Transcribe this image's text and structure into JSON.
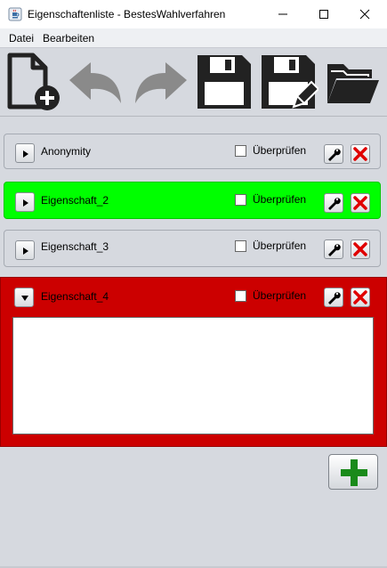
{
  "window": {
    "title": "Eigenschaftenliste - BestesWahlverfahren",
    "icon": "java-coffee-icon"
  },
  "menu": {
    "items": [
      "Datei",
      "Bearbeiten"
    ]
  },
  "toolbar": {
    "icons": [
      "new-document-icon",
      "undo-icon",
      "redo-icon",
      "save-icon",
      "save-as-icon",
      "open-folder-icon"
    ]
  },
  "properties": [
    {
      "name": "Anonymity",
      "checkbox_label": "Überprüfen",
      "checked": false,
      "expanded": false,
      "status_color": "#d6d9df"
    },
    {
      "name": "Eigenschaft_2",
      "checkbox_label": "Überprüfen",
      "checked": false,
      "expanded": false,
      "status_color": "#00ff00"
    },
    {
      "name": "Eigenschaft_3",
      "checkbox_label": "Überprüfen",
      "checked": false,
      "expanded": false,
      "status_color": "#d6d9df"
    },
    {
      "name": "Eigenschaft_4",
      "checkbox_label": "Überprüfen",
      "checked": false,
      "expanded": true,
      "status_color": "#cc0000",
      "text": ""
    }
  ],
  "colors": {
    "accent_add": "#1a8a1a",
    "delete": "#e00000"
  }
}
